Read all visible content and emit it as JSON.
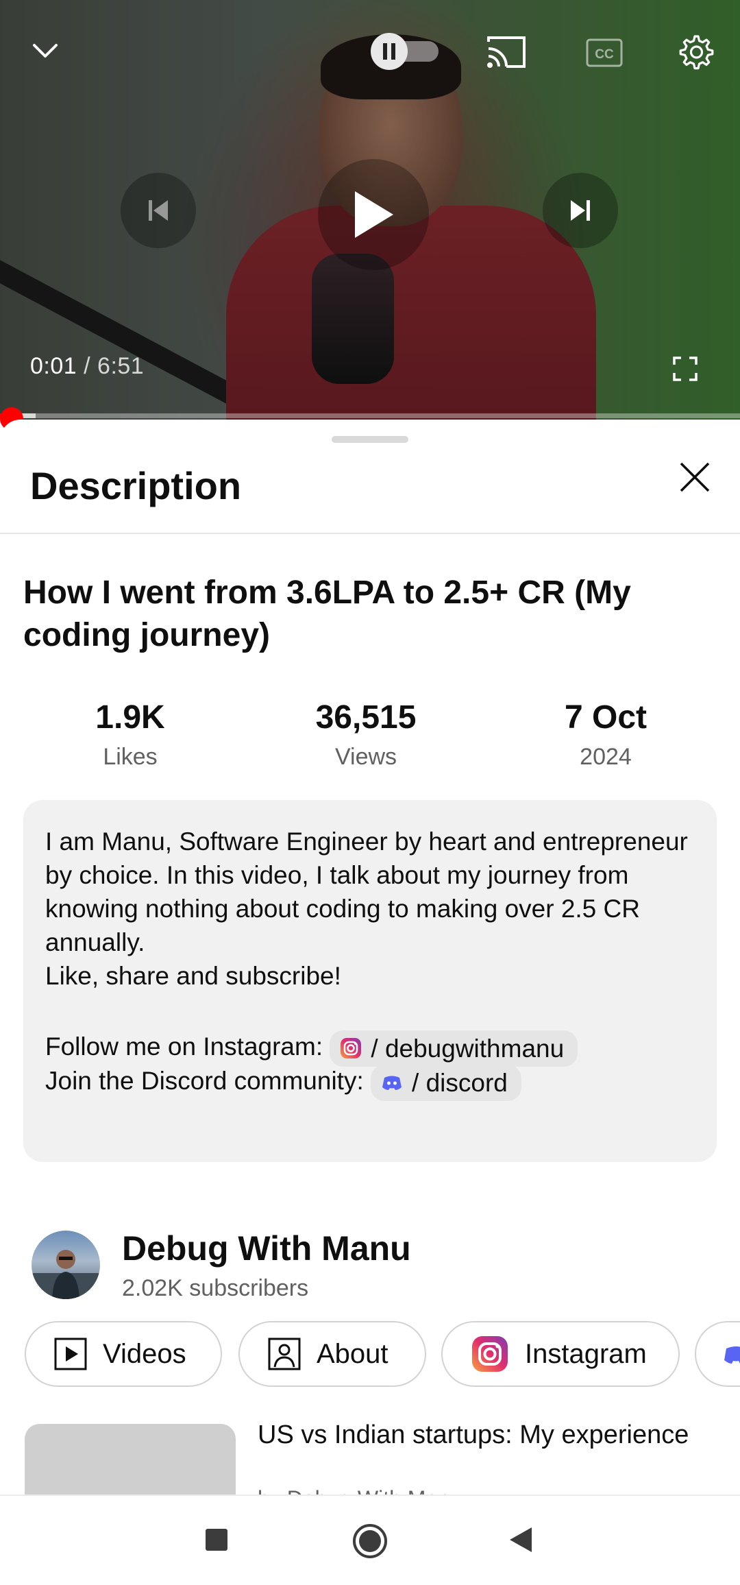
{
  "player": {
    "current_time": "0:01",
    "separator": " / ",
    "duration": "6:51",
    "progress_fraction": 0.0024,
    "autoplay_state": "paused"
  },
  "sheet": {
    "title": "Description"
  },
  "video": {
    "title": "How I went from 3.6LPA to 2.5+ CR (My coding journey)",
    "stats": [
      {
        "value": "1.9K",
        "label": "Likes"
      },
      {
        "value": "36,515",
        "label": "Views"
      },
      {
        "value": "7 Oct",
        "label": "2024"
      }
    ]
  },
  "description": {
    "paragraph1": "I am Manu, Software Engineer by heart and entrepreneur by choice. In this video, I talk about my journey from knowing nothing about coding to making over 2.5 CR annually.",
    "paragraph2": "Like, share and subscribe!",
    "instagram_prefix": "Follow me on Instagram:",
    "instagram_link": "/ debugwithmanu",
    "discord_prefix": "Join the Discord community:",
    "discord_link": "/ discord"
  },
  "channel": {
    "name": "Debug With Manu",
    "subscribers": "2.02K subscribers",
    "tabs": [
      {
        "label": "Videos",
        "icon": "play-box-icon"
      },
      {
        "label": "About",
        "icon": "person-box-icon"
      },
      {
        "label": "Instagram",
        "icon": "instagram-icon"
      }
    ]
  },
  "related": {
    "title": "US vs Indian startups: My experience",
    "subtitle": "by Debug With Manu"
  },
  "colors": {
    "accent_red": "#ff0000",
    "instagram": "#e1306c",
    "discord": "#5865f2"
  }
}
